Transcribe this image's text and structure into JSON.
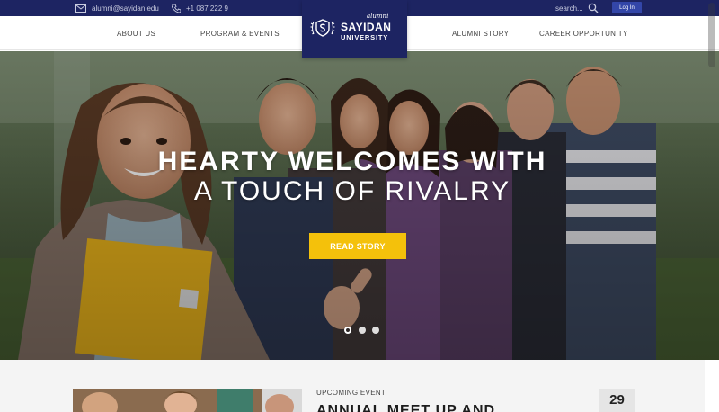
{
  "topbar": {
    "email": "alumni@sayidan.edu",
    "phone": "+1 087 222 9",
    "search_placeholder": "search...",
    "login_label": "Log In"
  },
  "nav": {
    "items": [
      {
        "label": "ABOUT US"
      },
      {
        "label": "PROGRAM & EVENTS"
      },
      {
        "label": "ALUMNI STORY"
      },
      {
        "label": "CAREER OPPORTUNITY"
      }
    ]
  },
  "logo": {
    "alumni": "alumni",
    "name": "SAYIDAN",
    "sub": "UNIVERSITY"
  },
  "hero": {
    "title": "HEARTY WELCOMES WITH",
    "subtitle": "A TOUCH OF RIVALRY",
    "button": "READ STORY",
    "slides": 3,
    "active_slide": 1
  },
  "event": {
    "label": "UPCOMING EVENT",
    "title": "ANNUAL MEET UP AND",
    "day": "29"
  },
  "colors": {
    "navy": "#1d2462",
    "accent_yellow": "#f4c10b",
    "login_blue": "#3346a8"
  }
}
